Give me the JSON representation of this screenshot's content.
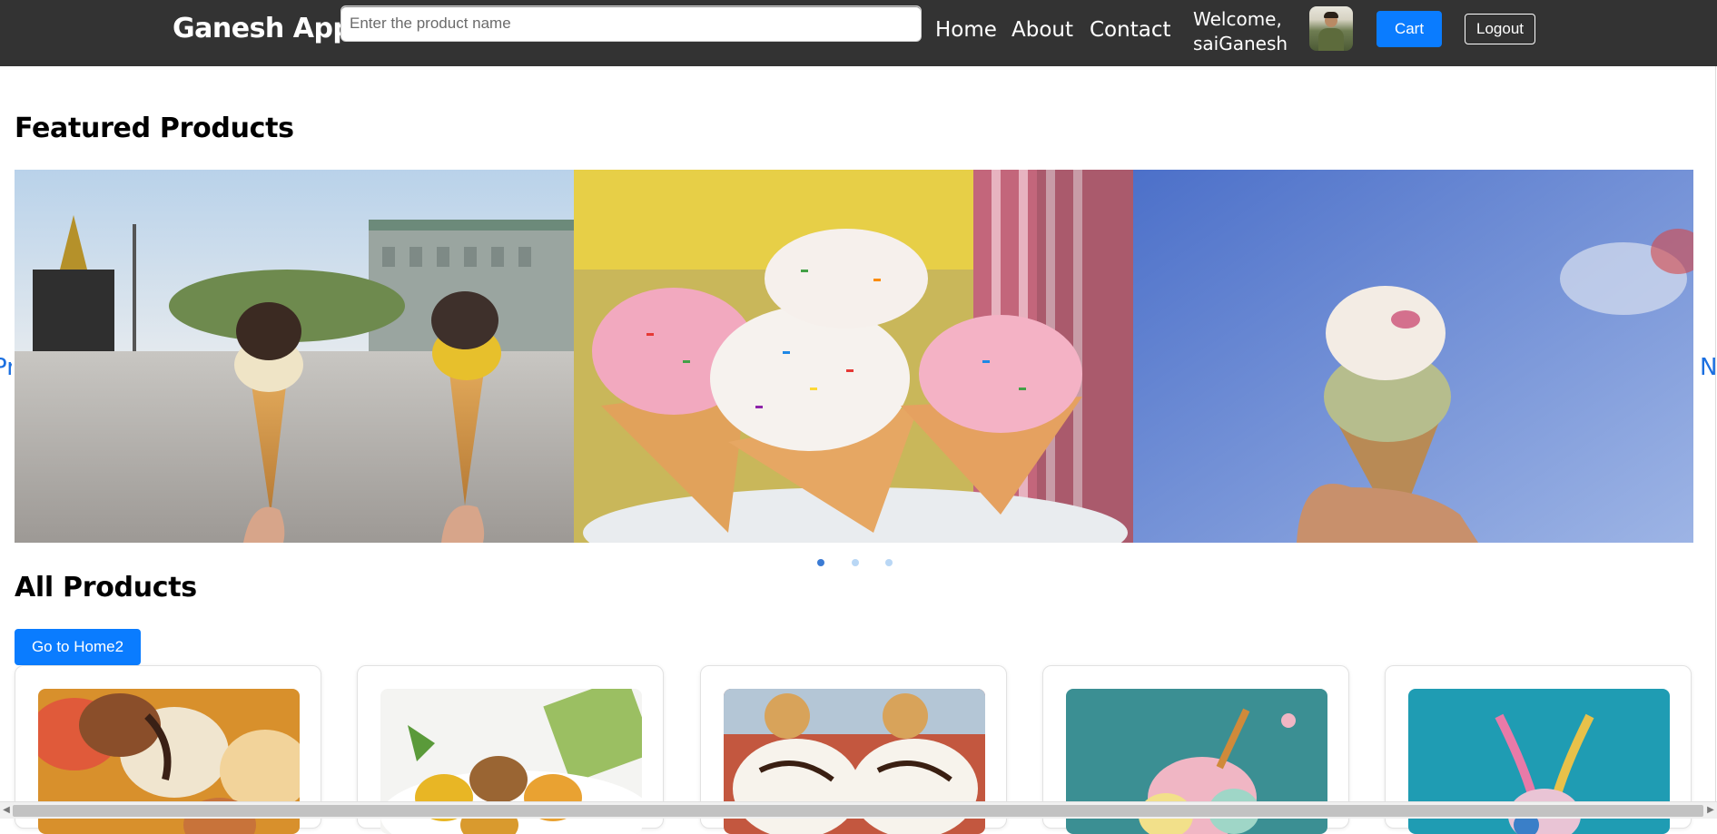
{
  "navbar": {
    "brand": "Ganesh App",
    "search_placeholder": "Enter the product name",
    "links": [
      "Home",
      "About",
      "Contact"
    ],
    "welcome_line1": "Welcome,",
    "welcome_line2": "saiGanesh",
    "cart_label": "Cart",
    "logout_label": "Logout"
  },
  "featured": {
    "heading": "Featured Products",
    "prev_label": "Previous",
    "next_label": "Next",
    "slide_count": 3,
    "active_slide": 1
  },
  "all_products": {
    "heading": "All Products",
    "home2_label": "Go to Home2"
  },
  "colors": {
    "navbar_bg": "#333333",
    "primary_blue": "#0a7cff",
    "arrow_blue": "#1b6fe0",
    "dot_active": "#3b7bd4",
    "dot_inactive": "#b9d7f5"
  }
}
